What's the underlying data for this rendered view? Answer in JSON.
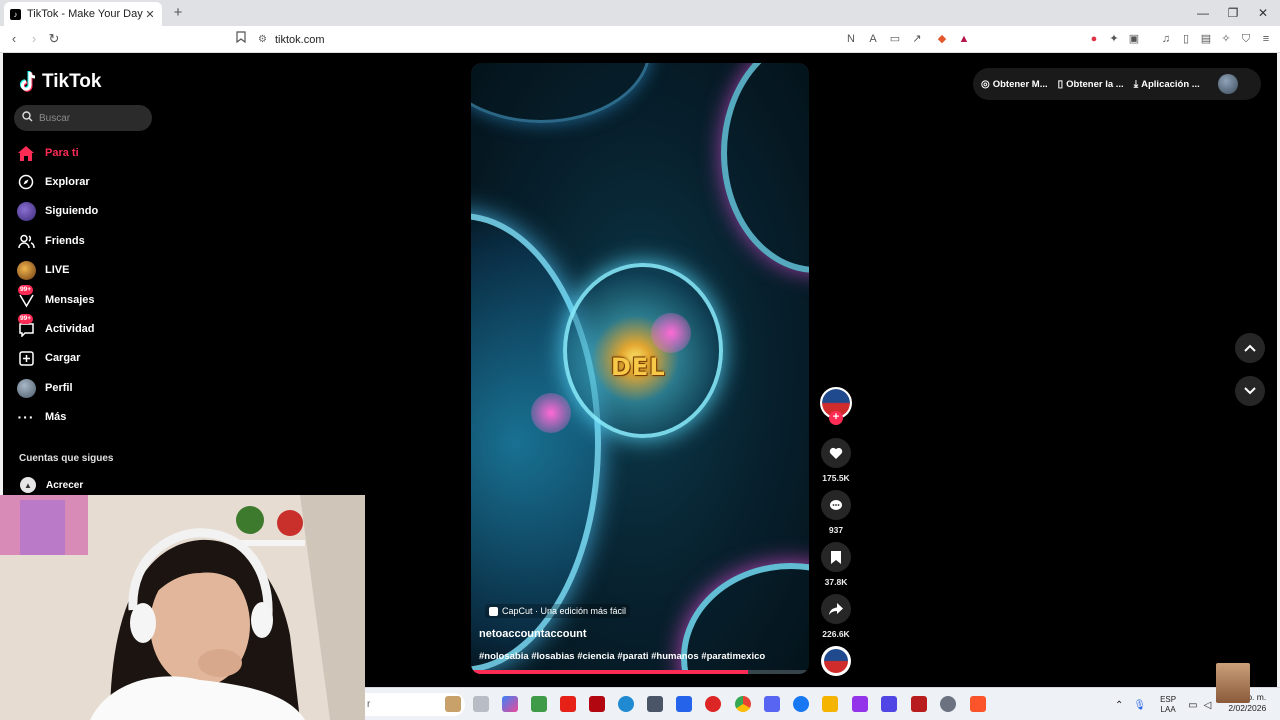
{
  "browser": {
    "tab_title": "TikTok - Make Your Day",
    "tab_favicon": "tiktok-logo-icon",
    "url": "tiktok.com",
    "new_tab": "+",
    "window_controls": [
      "minimize-icon",
      "restore-icon",
      "close-icon"
    ]
  },
  "sidebar": {
    "brand": "TikTok",
    "search_placeholder": "Buscar",
    "items": [
      {
        "label": "Para ti",
        "icon": "home-icon",
        "active": true
      },
      {
        "label": "Explorar",
        "icon": "compass-icon"
      },
      {
        "label": "Siguiendo",
        "icon": "following-avatar"
      },
      {
        "label": "Friends",
        "icon": "friends-icon"
      },
      {
        "label": "LIVE",
        "icon": "live-avatar"
      },
      {
        "label": "Mensajes",
        "icon": "inbox-icon",
        "badge": "99+"
      },
      {
        "label": "Actividad",
        "icon": "activity-icon",
        "badge": "99+"
      },
      {
        "label": "Cargar",
        "icon": "upload-icon"
      },
      {
        "label": "Perfil",
        "icon": "profile-avatar"
      },
      {
        "label": "Más",
        "icon": "more-dots-icon"
      }
    ],
    "following_title": "Cuentas que sigues",
    "following": [
      {
        "label": "Acrecer"
      }
    ]
  },
  "header_actions": [
    {
      "label": "Obtener M...",
      "icon": "coin-icon"
    },
    {
      "label": "Obtener la ...",
      "icon": "phone-icon"
    },
    {
      "label": "Aplicación ...",
      "icon": "download-icon"
    }
  ],
  "video": {
    "overlay_text": "DEL",
    "capcut_label": "CapCut · Una edición más fácil",
    "author": "netoaccountaccount",
    "hashtags": "#nolosabia #losabias #ciencia #parati #humanos #paratimexico",
    "progress": 0.82
  },
  "actions": {
    "likes": "175.5K",
    "comments": "937",
    "saves": "37.8K",
    "shares": "226.6K"
  },
  "taskbar": {
    "tray_lang_top": "ESP",
    "tray_lang_bottom": "LAA",
    "clock_time": "…04 p. m.",
    "clock_date": "2/02/2026"
  },
  "colors": {
    "accent": "#fe2c55",
    "background": "#000000"
  }
}
